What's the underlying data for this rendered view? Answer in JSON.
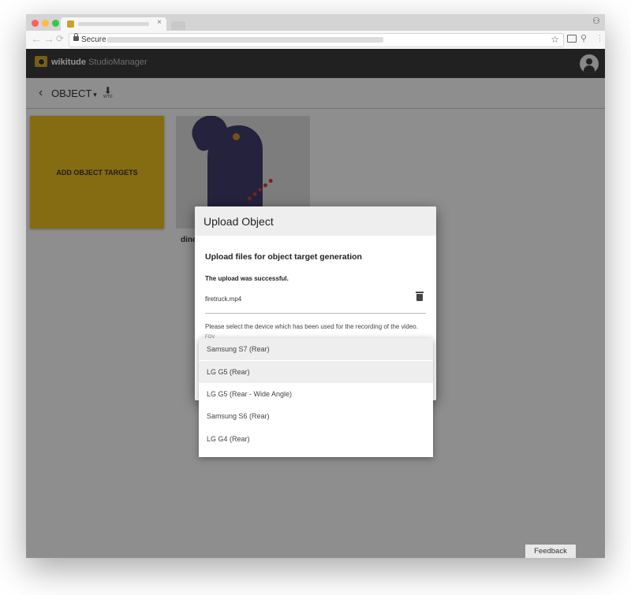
{
  "browser": {
    "tab_close": "×",
    "secure_label": "Secure",
    "back_glyph": "←",
    "forward_glyph": "→",
    "reload_glyph": "⟳",
    "star_glyph": "☆",
    "ext_glyph": "⚲",
    "profile_glyph": "⚇",
    "menu_glyph": "⋮"
  },
  "app": {
    "logo_bold": "wikitude",
    "logo_light": "StudioManager"
  },
  "subbar": {
    "back_glyph": "‹",
    "object_label": "OBJECT",
    "caret": "▾",
    "download_glyph": "⬇",
    "download_label": "WTO"
  },
  "cards": {
    "add_label": "ADD OBJECT TARGETS",
    "image_name": "dino"
  },
  "dialog": {
    "title": "Upload Object",
    "subtitle": "Upload files for object target generation",
    "success": "The upload was successful.",
    "file_name": "firetruck.mp4",
    "select_prompt": "Please select the device which has been used for the recording of the video.",
    "fov_label": "FOV"
  },
  "device_menu": {
    "options": [
      "Samsung S7 (Rear)",
      "LG G5 (Rear)",
      "LG G5 (Rear - Wide Angle)",
      "Samsung S6 (Rear)",
      "LG G4 (Rear)"
    ],
    "highlighted": [
      0,
      1
    ]
  },
  "feedback_label": "Feedback",
  "colors": {
    "accent": "#e6b91e",
    "appbar": "#3a3a3a",
    "traffic_red": "#fc605b",
    "traffic_yellow": "#fdbc40",
    "traffic_green": "#34c84a"
  }
}
